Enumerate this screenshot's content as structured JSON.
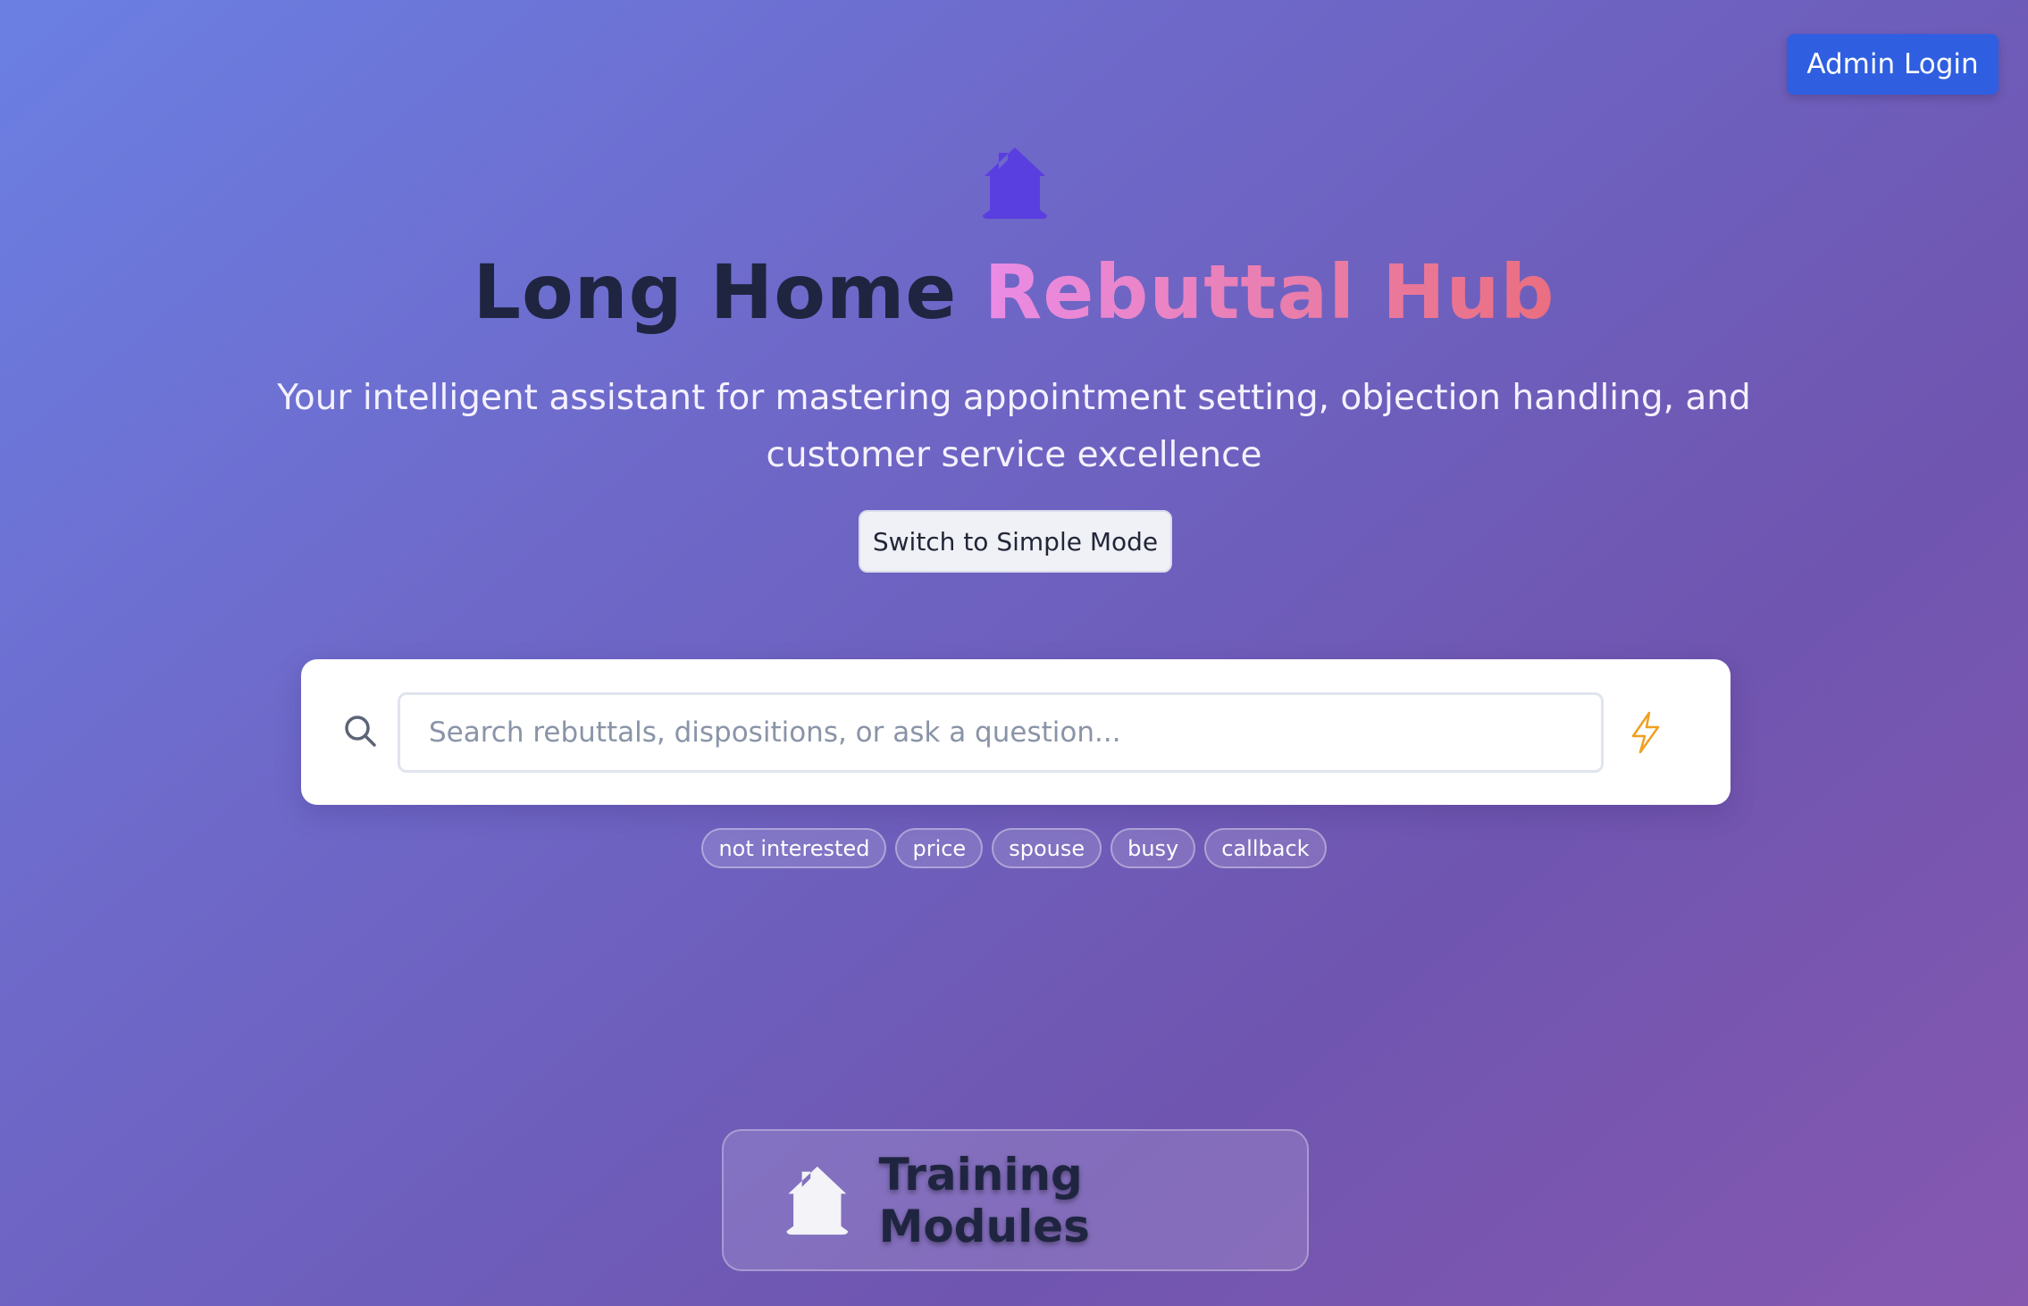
{
  "header": {
    "admin_login_label": "Admin Login"
  },
  "hero": {
    "icon": "house-icon",
    "title_main": "Long Home",
    "title_accent": "Rebuttal Hub",
    "subtitle": "Your intelligent assistant for mastering appointment setting, objection handling, and customer service excellence",
    "mode_button_label": "Switch to Simple Mode"
  },
  "search": {
    "placeholder": "Search rebuttals, dispositions, or ask a question...",
    "value": "",
    "icon": "search-icon",
    "action_icon": "lightning-icon",
    "suggestions": [
      "not interested",
      "price",
      "spouse",
      "busy",
      "callback"
    ]
  },
  "modules": {
    "icon": "house-icon",
    "label": "Training Modules"
  },
  "colors": {
    "admin_button": "#2f5fe0",
    "title_dark": "#1f2540",
    "accent_start": "#ea8ce6",
    "accent_end": "#ea6e7f",
    "house_icon": "#5a3fe0",
    "bolt": "#f0a020"
  }
}
